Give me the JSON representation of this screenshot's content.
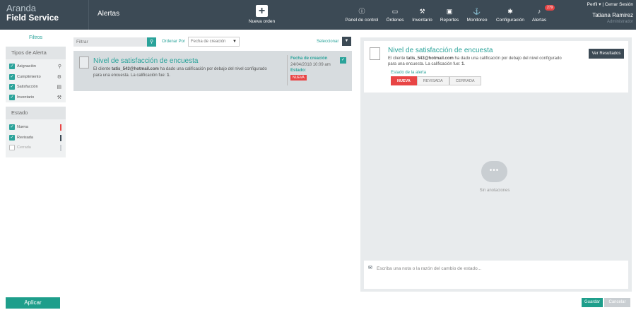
{
  "header": {
    "logo_line1": "Aranda",
    "logo_line2": "Field Service",
    "page_title": "Alertas",
    "new_order_label": "Nueva orden",
    "nav": [
      {
        "label": "Panel de control",
        "icon": "info-icon"
      },
      {
        "label": "Órdenes",
        "icon": "calendar-icon"
      },
      {
        "label": "Inventario",
        "icon": "wrench-icon"
      },
      {
        "label": "Reportes",
        "icon": "report-icon"
      },
      {
        "label": "Monitoreo",
        "icon": "person-pin-icon"
      },
      {
        "label": "Configuración",
        "icon": "gear-icon"
      },
      {
        "label": "Alertas",
        "icon": "bell-icon",
        "badge": "279"
      }
    ],
    "profile_link": "Perfil",
    "logout_link": "Cerrar Sesión",
    "user_name": "Tatiana Ramirez",
    "user_role": "Administrador"
  },
  "sidebar": {
    "title": "Filtros",
    "alert_types_title": "Tipos de Alerta",
    "alert_types": [
      {
        "label": "Asignación",
        "checked": true,
        "icon": "assign-icon"
      },
      {
        "label": "Cumplimiento",
        "checked": true,
        "icon": "compliance-icon"
      },
      {
        "label": "Satisfacción",
        "checked": true,
        "icon": "satisfaction-icon"
      },
      {
        "label": "Inventario",
        "checked": true,
        "icon": "inventory-icon"
      }
    ],
    "state_title": "Estado",
    "states": [
      {
        "label": "Nueva",
        "checked": true,
        "color": "#e84545"
      },
      {
        "label": "Revisada",
        "checked": true,
        "color": "#3c4a55"
      },
      {
        "label": "Cerrada",
        "checked": false,
        "color": "#c9ced2"
      }
    ],
    "apply_label": "Aplicar"
  },
  "list": {
    "filter_placeholder": "Filtrar",
    "order_by_label": "Ordenar Por",
    "order_by_value": "Fecha de creación",
    "select_label": "Seleccionar",
    "items": [
      {
        "title": "Nivel de satisfacción de encuesta",
        "body_prefix": "El cliente ",
        "body_email": "tatis_543@hotmail.com",
        "body_rest": " ha dado una calificación por debajo del nivel configurado para una encuesta. La calificación fue: ",
        "body_score": "1",
        "created_label": "Fecha de creación",
        "created_value": "24/04/2018 10:09 am",
        "state_label": "Estado:",
        "state_value": "NUEVA"
      }
    ]
  },
  "detail": {
    "title": "Nivel de satisfacción de encuesta",
    "body_prefix": "El cliente ",
    "body_email": "tatis_543@hotmail.com",
    "body_rest": " ha dado una calificación por debajo del nivel configurado para una encuesta. La calificación fue: ",
    "body_score": "1",
    "results_button": "Ver Resultados",
    "state_label": "Estado de la alerta",
    "state_options": [
      "NUEVA",
      "REVISADA",
      "CERRADA"
    ],
    "empty_label": "Sin anotaciones",
    "note_placeholder": "Escriba una nota o la razón del cambio de estado...",
    "save_label": "Guardar",
    "cancel_label": "Cancelar"
  },
  "colors": {
    "topbar": "#3c4a55",
    "accent": "#2aa39a",
    "new_state": "#e84545"
  }
}
